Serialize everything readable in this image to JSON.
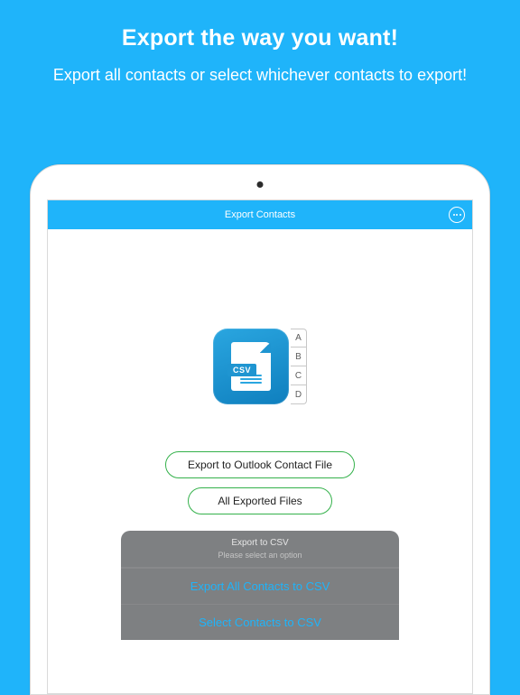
{
  "hero": {
    "title": "Export the way you want!",
    "subtitle": "Export all contacts or select whichever contacts to export!"
  },
  "navbar": {
    "title": "Export Contacts"
  },
  "icon": {
    "badge": "CSV",
    "index": [
      "A",
      "B",
      "C",
      "D"
    ]
  },
  "buttons": {
    "outlook": "Export to Outlook Contact File",
    "files": "All Exported Files"
  },
  "sheet": {
    "title": "Export to CSV",
    "subtitle": "Please select an option",
    "options": [
      "Export All Contacts to CSV",
      "Select Contacts to CSV"
    ]
  }
}
